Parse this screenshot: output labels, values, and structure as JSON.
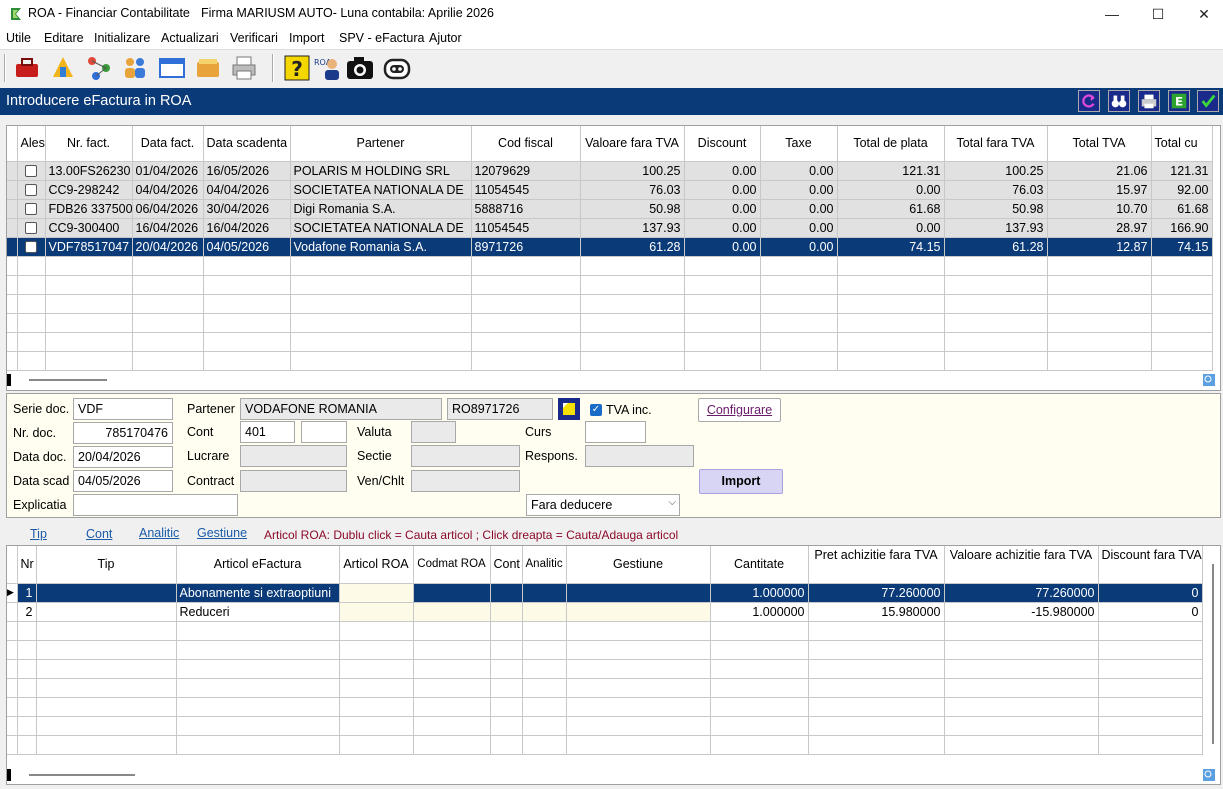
{
  "window": {
    "app_title": "ROA - Financiar Contabilitate",
    "company_title": "Firma MARIUSM AUTO- Luna contabila: Aprilie 2026",
    "min": "—",
    "max": "☐",
    "close": "✕"
  },
  "menu": [
    "Utile",
    "Editare",
    "Initializare",
    "Actualizari",
    "Verificari",
    "Import",
    "SPV - eFactura",
    "Ajutor"
  ],
  "toolbar_icons": [
    "toolbox-icon",
    "hierarchy-icon",
    "network-icon",
    "users-icon",
    "window-icon",
    "wallet-icon",
    "printer-icon",
    "help-icon",
    "roa-user-icon",
    "camera-icon",
    "robot-icon"
  ],
  "header": {
    "title": "Introducere eFactura in ROA"
  },
  "invoices": {
    "columns": [
      "Ales",
      "Nr. fact.",
      "Data fact.",
      "Data scadenta",
      "Partener",
      "Cod fiscal",
      "Valoare fara TVA",
      "Discount",
      "Taxe",
      "Total de plata",
      "Total fara TVA",
      "Total TVA",
      "Total cu"
    ],
    "rows": [
      [
        "13.00FS26230",
        "01/04/2026",
        "16/05/2026",
        "POLARIS M HOLDING SRL",
        "12079629",
        "100.25",
        "0.00",
        "0.00",
        "121.31",
        "100.25",
        "21.06",
        "121.31"
      ],
      [
        "CC9-298242",
        "04/04/2026",
        "04/04/2026",
        "SOCIETATEA NATIONALA DE",
        "11054545",
        "76.03",
        "0.00",
        "0.00",
        "0.00",
        "76.03",
        "15.97",
        "92.00"
      ],
      [
        "FDB26 337500",
        "06/04/2026",
        "30/04/2026",
        "Digi Romania S.A.",
        "5888716",
        "50.98",
        "0.00",
        "0.00",
        "61.68",
        "50.98",
        "10.70",
        "61.68"
      ],
      [
        "CC9-300400",
        "16/04/2026",
        "16/04/2026",
        "SOCIETATEA NATIONALA DE",
        "11054545",
        "137.93",
        "0.00",
        "0.00",
        "0.00",
        "137.93",
        "28.97",
        "166.90"
      ],
      [
        "VDF78517047",
        "20/04/2026",
        "04/05/2026",
        "Vodafone Romania S.A.",
        "8971726",
        "61.28",
        "0.00",
        "0.00",
        "74.15",
        "61.28",
        "12.87",
        "74.15"
      ]
    ]
  },
  "form": {
    "serie_label": "Serie doc.",
    "serie": "VDF",
    "nr_label": "Nr. doc.",
    "nr": "785170476",
    "data_doc_label": "Data doc.",
    "data_doc": "20/04/2026",
    "data_scad_label": "Data scad",
    "data_scad": "04/05/2026",
    "explicatia_label": "Explicatia",
    "explicatia": "",
    "partener_label": "Partener",
    "partener": "VODAFONE ROMANIA",
    "cod_fiscal": "RO8971726",
    "tva_inc_label": "TVA inc.",
    "cont_label": "Cont",
    "cont": "401",
    "cont2": "",
    "lucrare_label": "Lucrare",
    "contract_label": "Contract",
    "valuta_label": "Valuta",
    "sectie_label": "Sectie",
    "ven_label": "Ven/Chlt",
    "curs_label": "Curs",
    "respons_label": "Respons.",
    "configurare": "Configurare",
    "import": "Import",
    "deducere": "Fara deducere"
  },
  "links": {
    "tip": "Tip",
    "cont": "Cont",
    "analitic": "Analitic",
    "gestiune": "Gestiune",
    "hint": "Articol ROA: Dublu click = Cauta articol ;  Click dreapta = Cauta/Adauga articol"
  },
  "articles": {
    "columns": [
      "Nr",
      "Tip",
      "Articol eFactura",
      "Articol ROA",
      "Codmat ROA",
      "Cont",
      "Analitic",
      "Gestiune",
      "Cantitate",
      "Pret achizitie fara TVA",
      "Valoare achizitie fara TVA",
      "Discount fara TVA"
    ],
    "rows": [
      [
        "1",
        "",
        "Abonamente si extraoptiuni",
        "",
        "",
        "",
        "",
        "",
        "1.000000",
        "77.260000",
        "77.260000",
        "0"
      ],
      [
        "2",
        "",
        "Reduceri",
        "",
        "",
        "",
        "",
        "",
        "1.000000",
        "15.980000",
        "-15.980000",
        "0"
      ]
    ]
  },
  "colors": {
    "header_bg": "#0a3a78",
    "selected_row": "#0a3a78",
    "form_bg": "#fffef0",
    "hint": "#8b0a2a"
  }
}
